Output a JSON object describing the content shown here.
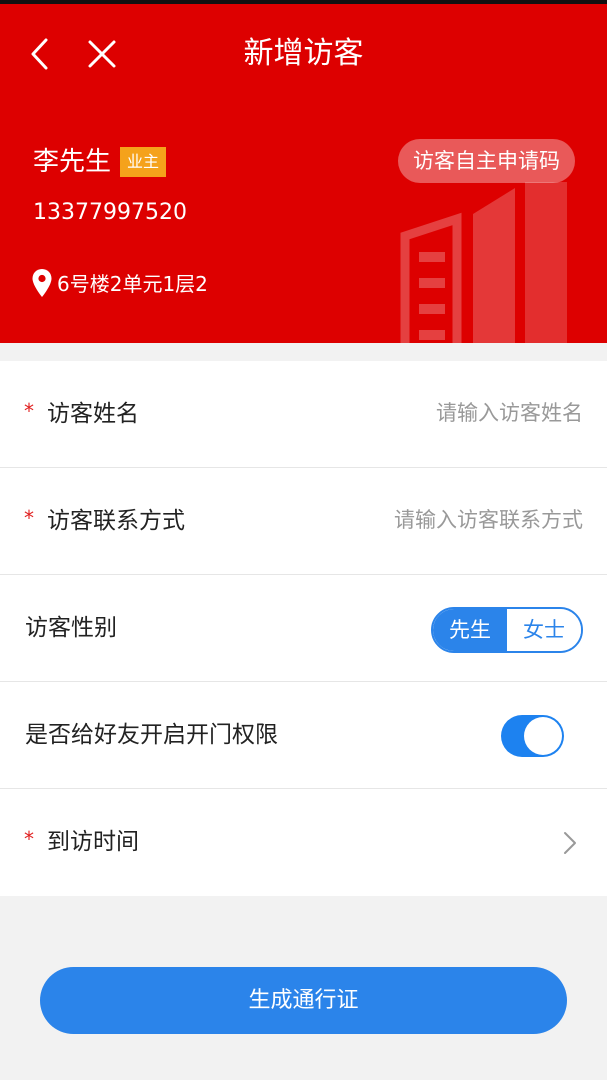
{
  "header": {
    "title": "新增访客",
    "back_icon": "chevron-left-icon",
    "close_icon": "close-icon"
  },
  "owner": {
    "name": "李先生",
    "badge": "业主",
    "phone": "13377997520",
    "address": "6号楼2单元1层2",
    "self_apply_label": "访客自主申请码"
  },
  "form": {
    "visitor_name": {
      "label": "访客姓名",
      "placeholder": "请输入访客姓名",
      "value": "",
      "required": true
    },
    "visitor_contact": {
      "label": "访客联系方式",
      "placeholder": "请输入访客联系方式",
      "value": "",
      "required": true
    },
    "visitor_gender": {
      "label": "访客性别",
      "options": [
        "先生",
        "女士"
      ],
      "selected": "先生"
    },
    "door_permission": {
      "label": "是否给好友开启开门权限",
      "enabled": true
    },
    "visit_time": {
      "label": "到访时间",
      "value": "",
      "required": true
    }
  },
  "submit_label": "生成通行证",
  "colors": {
    "header_bg": "#dd0000",
    "badge_bg": "#f5a21b",
    "accent": "#2b84ea",
    "switch_on": "#1d82f0",
    "required_star": "#e02020"
  }
}
